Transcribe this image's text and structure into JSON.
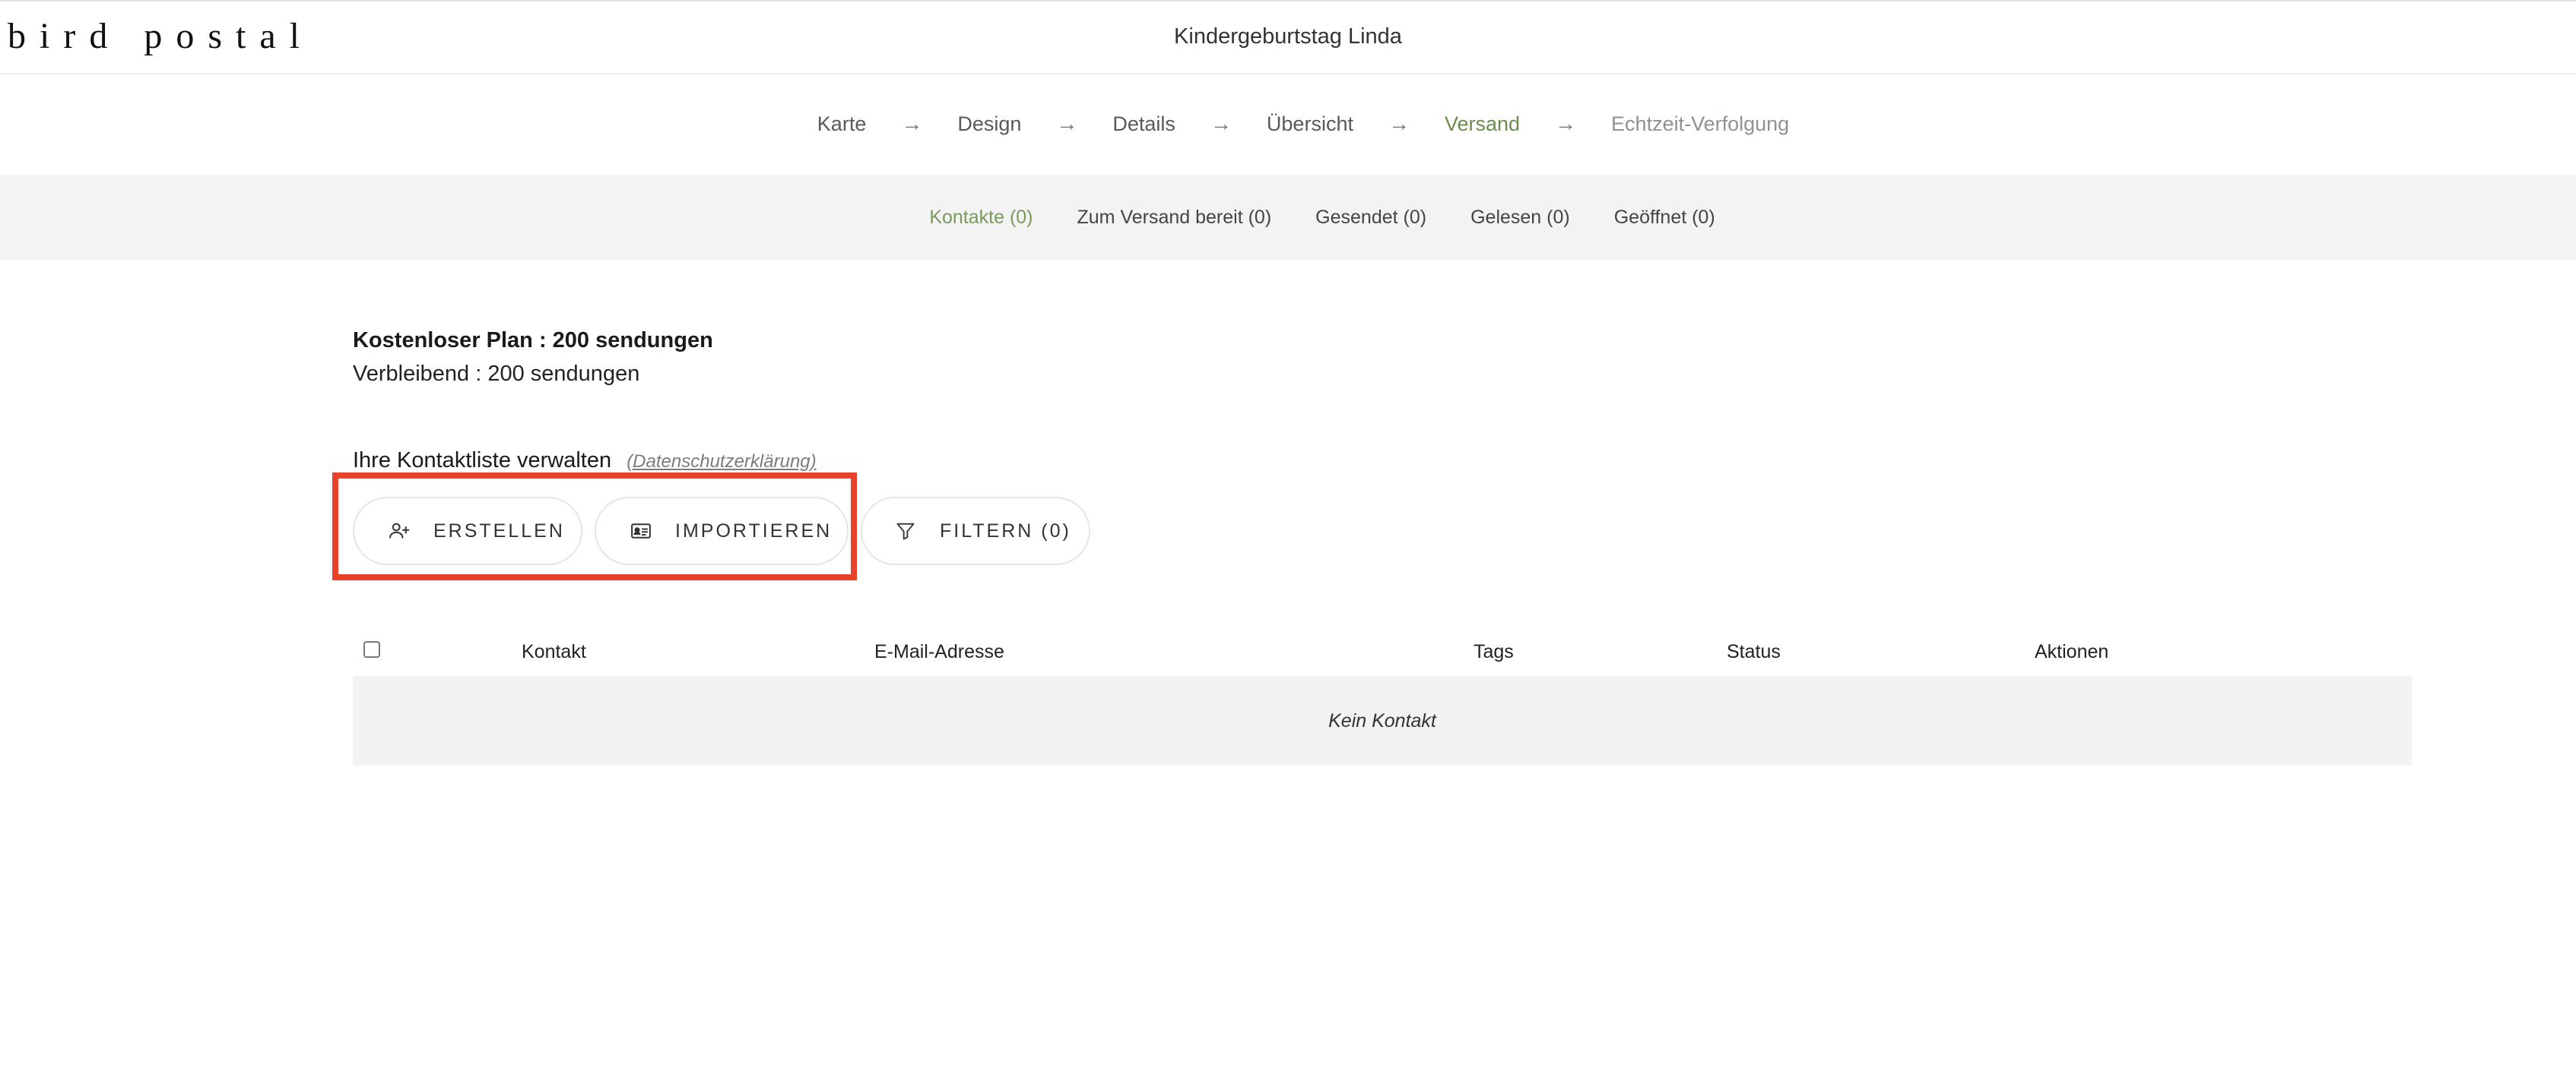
{
  "header": {
    "logo": "bird postal",
    "title": "Kindergeburtstag Linda"
  },
  "steps": [
    {
      "label": "Karte",
      "state": "done"
    },
    {
      "label": "Design",
      "state": "done"
    },
    {
      "label": "Details",
      "state": "done"
    },
    {
      "label": "Übersicht",
      "state": "done"
    },
    {
      "label": "Versand",
      "state": "active"
    },
    {
      "label": "Echtzeit-Verfolgung",
      "state": "future"
    }
  ],
  "step_arrow": "→",
  "tabs": [
    {
      "label": "Kontakte (0)",
      "active": true
    },
    {
      "label": "Zum Versand bereit (0)",
      "active": false
    },
    {
      "label": "Gesendet (0)",
      "active": false
    },
    {
      "label": "Gelesen (0)",
      "active": false
    },
    {
      "label": "Geöffnet (0)",
      "active": false
    }
  ],
  "plan": {
    "plan_line": "Kostenloser Plan : 200 sendungen",
    "remaining_line": "Verbleibend : 200 sendungen"
  },
  "manage": {
    "title": "Ihre Kontaktliste verwalten",
    "privacy_link": "(Datenschutzerklärung)"
  },
  "buttons": {
    "create": "ERSTELLEN",
    "import": "IMPORTIEREN",
    "filter": "FILTERN (0)"
  },
  "table": {
    "columns": {
      "contact": "Kontakt",
      "email": "E-Mail-Adresse",
      "tags": "Tags",
      "status": "Status",
      "actions": "Aktionen"
    },
    "empty_text": "Kein Kontakt"
  },
  "colors": {
    "accent_green": "#6b8e4e",
    "highlight_red": "#e8432a",
    "tabbar_bg": "#f3f3f3"
  },
  "icons": {
    "create": "add-user-icon",
    "import": "contact-card-icon",
    "filter": "filter-icon"
  }
}
